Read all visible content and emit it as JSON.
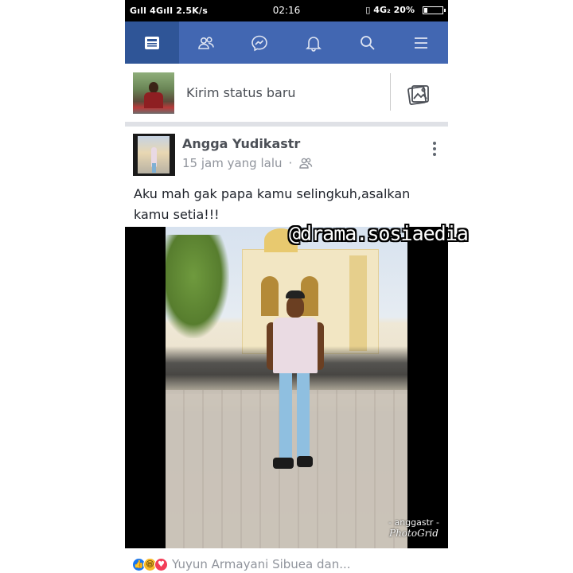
{
  "status_bar": {
    "network_left": "Gıll 4Gıll",
    "speed": "2.5K/s",
    "time": "02:16",
    "network_right": "4G₂",
    "battery": "20%",
    "battery_level": 0.2
  },
  "nav": {
    "tabs": [
      {
        "name": "news-feed",
        "icon": "news-feed-icon",
        "active": true
      },
      {
        "name": "friends",
        "icon": "friends-icon",
        "active": false
      },
      {
        "name": "messenger",
        "icon": "messenger-icon",
        "active": false
      },
      {
        "name": "notifications",
        "icon": "bell-icon",
        "active": false
      },
      {
        "name": "search",
        "icon": "search-icon",
        "active": false
      },
      {
        "name": "menu",
        "icon": "menu-icon",
        "active": false
      }
    ],
    "bar_color": "#4267b2",
    "active_color": "#2f5597"
  },
  "composer": {
    "placeholder": "Kirim status baru",
    "photo_icon": "photo-icon"
  },
  "post": {
    "author": "Angga Yudikastr",
    "time": "15 jam yang lalu",
    "separator": "·",
    "audience_icon": "friends-icon",
    "text": "Aku mah gak papa kamu selingkuh,asalkan kamu setia!!!",
    "photo_credit": "- anggastr -",
    "photo_app": "PhotoGrid"
  },
  "watermark": {
    "handle": "@drama.sosiaedia"
  },
  "reactions": {
    "types": [
      "like",
      "haha",
      "love"
    ],
    "text": "Yuyun Armayani Sibuea dan..."
  }
}
